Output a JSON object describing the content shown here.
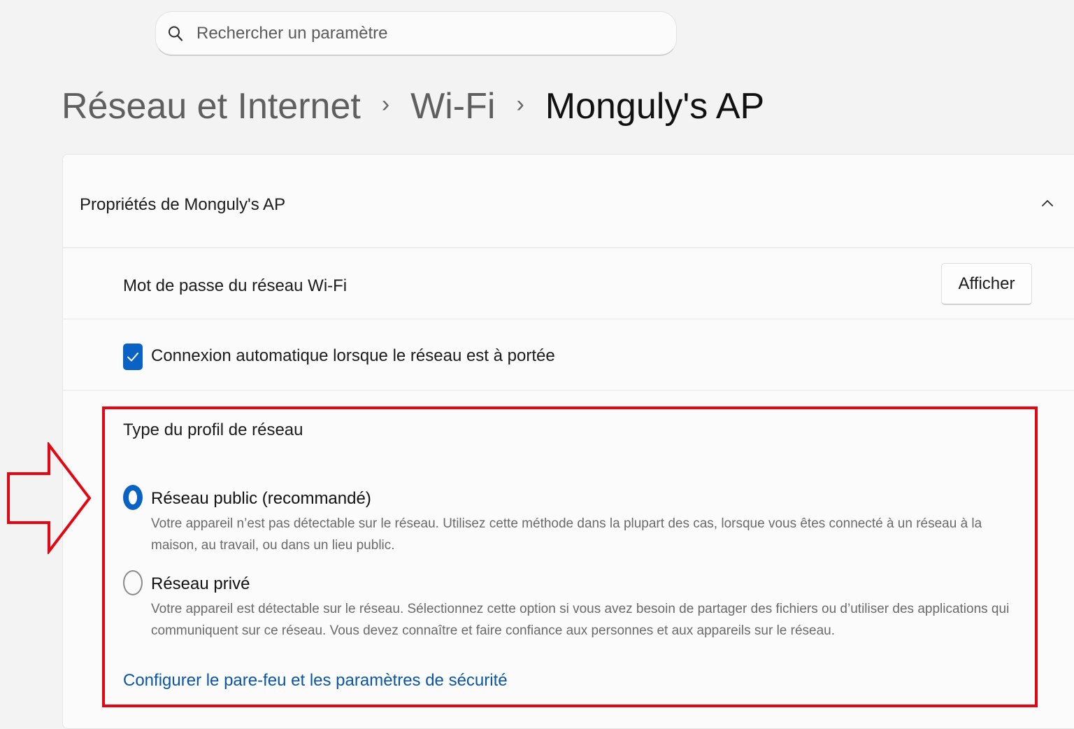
{
  "search": {
    "placeholder": "Rechercher un paramètre",
    "icon": "search-icon"
  },
  "breadcrumb": {
    "items": [
      "Réseau et Internet",
      "Wi-Fi",
      "Monguly's AP"
    ],
    "separator": "›"
  },
  "panel": {
    "title": "Propriétés de Monguly's AP",
    "collapse_icon": "chevron-up-icon",
    "password": {
      "label": "Mot de passe du réseau Wi-Fi",
      "button_label": "Afficher"
    },
    "autoconnect": {
      "label": "Connexion automatique lorsque le réseau est à portée",
      "checked": true
    },
    "profile": {
      "title": "Type du profil de réseau",
      "options": [
        {
          "title": "Réseau public (recommandé)",
          "description": "Votre appareil n’est pas détectable sur le réseau. Utilisez cette méthode dans la plupart des cas, lorsque vous êtes connecté à un réseau à la maison, au travail, ou dans un lieu public.",
          "selected": true
        },
        {
          "title": "Réseau privé",
          "description": "Votre appareil est détectable sur le réseau. Sélectionnez cette option si vous avez besoin de partager des fichiers ou d’utiliser des applications qui communiquent sur ce réseau. Vous devez connaître et faire confiance aux personnes et aux appareils sur le réseau.",
          "selected": false
        }
      ],
      "firewall_link": "Configurer le pare-feu et les paramètres de sécurité"
    }
  },
  "colors": {
    "accent": "#0a63c4",
    "link": "#0a55a8",
    "annotation": "#e30613",
    "background": "#f3f3f3",
    "card": "#fbfbfb"
  }
}
